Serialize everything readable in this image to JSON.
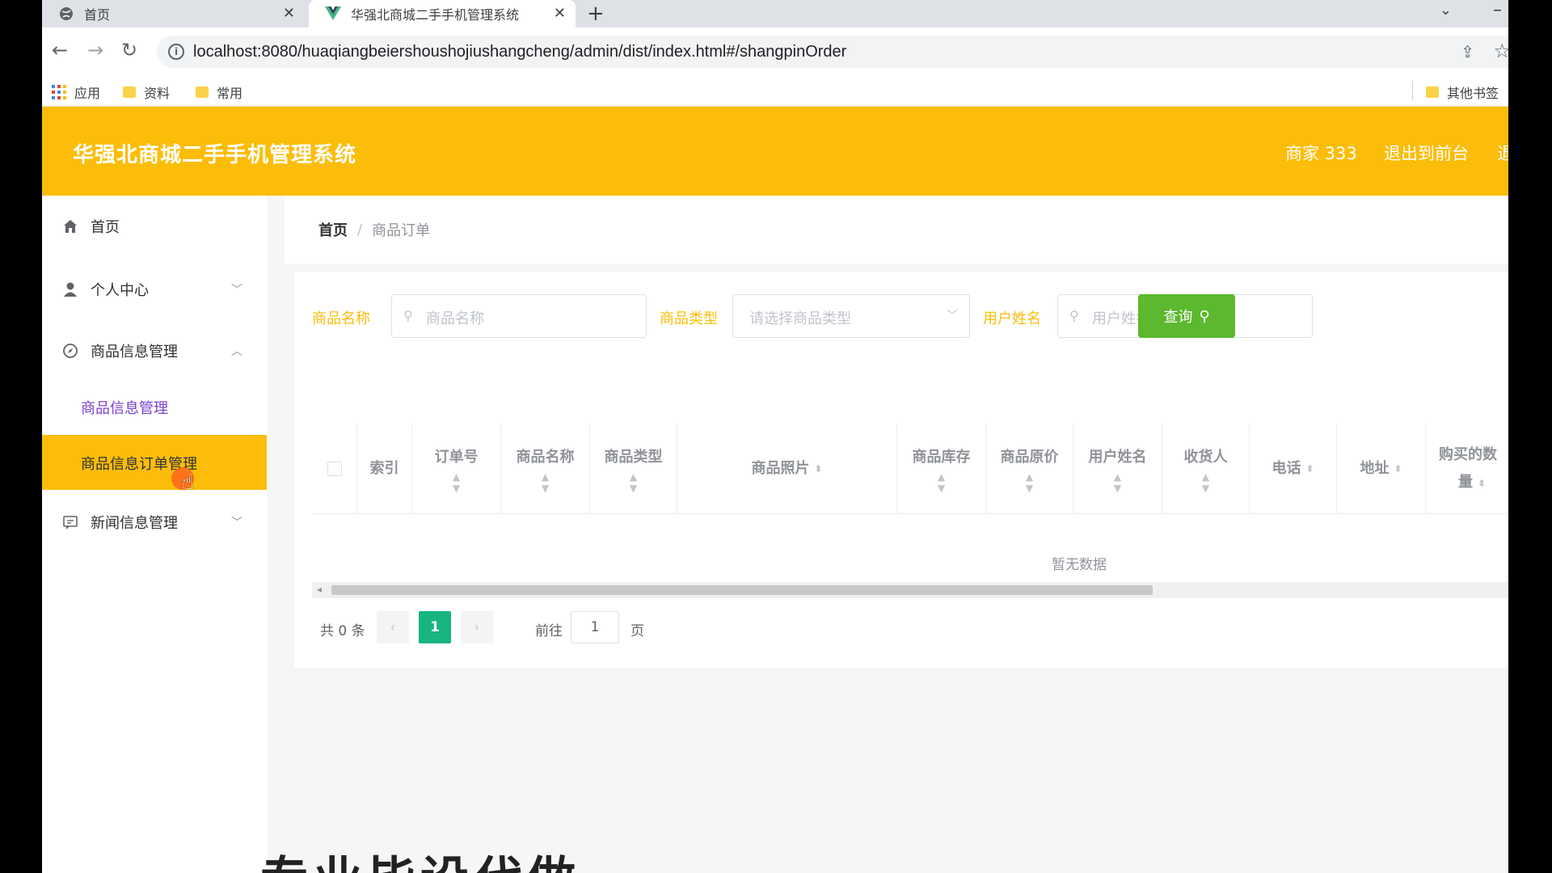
{
  "browser": {
    "tabs": [
      {
        "title": "首页"
      },
      {
        "title": "华强北商城二手手机管理系统"
      }
    ],
    "url": "localhost:8080/huaqiangbeiershoushojiushangcheng/admin/dist/index.html#/shangpinOrder",
    "bookmarks": [
      "应用",
      "资料",
      "常用"
    ],
    "other_bookmarks": "其他书签"
  },
  "header": {
    "title": "华强北商城二手手机管理系统",
    "user": "商家 333",
    "goto_front": "退出到前台",
    "logout_partial": "退"
  },
  "sidebar": {
    "items": [
      {
        "label": "首页"
      },
      {
        "label": "个人中心"
      },
      {
        "label": "商品信息管理"
      },
      {
        "label": "商品信息管理"
      },
      {
        "label": "商品信息订单管理"
      },
      {
        "label": "新闻信息管理"
      }
    ]
  },
  "breadcrumb": {
    "home": "首页",
    "separator": "/",
    "current": "商品订单"
  },
  "filters": {
    "name_label": "商品名称",
    "name_placeholder": "商品名称",
    "type_label": "商品类型",
    "type_placeholder": "请选择商品类型",
    "user_label": "用户姓名",
    "user_placeholder": "用户姓名",
    "query_button": "查询"
  },
  "table": {
    "columns": [
      "索引",
      "订单号",
      "商品名称",
      "商品类型",
      "商品照片",
      "商品库存",
      "商品原价",
      "用户姓名",
      "收货人",
      "电话",
      "地址",
      "购买的数量"
    ],
    "last_column_line1": "购买的数",
    "last_column_line2": "量",
    "empty_text": "暂无数据"
  },
  "pagination": {
    "total": "共 0 条",
    "current_page": "1",
    "goto_label": "前往",
    "goto_value": "1",
    "goto_unit": "页"
  },
  "overlay_text": "专业毕设代做",
  "colors": {
    "accent": "#fbbd09",
    "query_button": "#5cb82e",
    "page_active": "#19b57e"
  }
}
